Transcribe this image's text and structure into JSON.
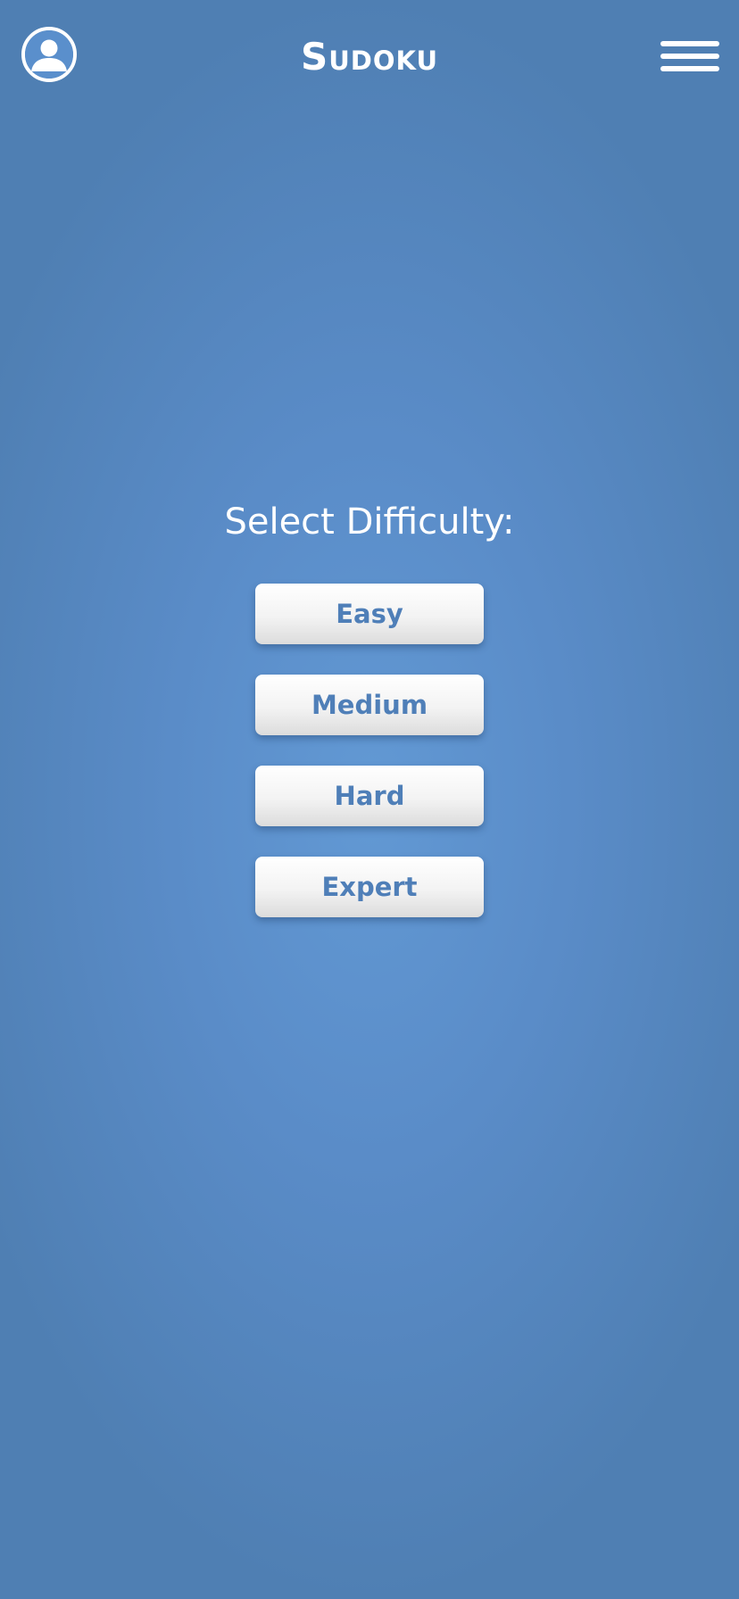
{
  "header": {
    "title": "Sudoku",
    "profile_icon": "user-circle-icon",
    "menu_icon": "hamburger-menu-icon"
  },
  "main": {
    "heading": "Select Difficulty:",
    "options": [
      {
        "label": "Easy"
      },
      {
        "label": "Medium"
      },
      {
        "label": "Hard"
      },
      {
        "label": "Expert"
      }
    ]
  },
  "colors": {
    "background": "#5a8cc8",
    "button_text": "#4f7fb8",
    "header_text": "#ffffff"
  }
}
